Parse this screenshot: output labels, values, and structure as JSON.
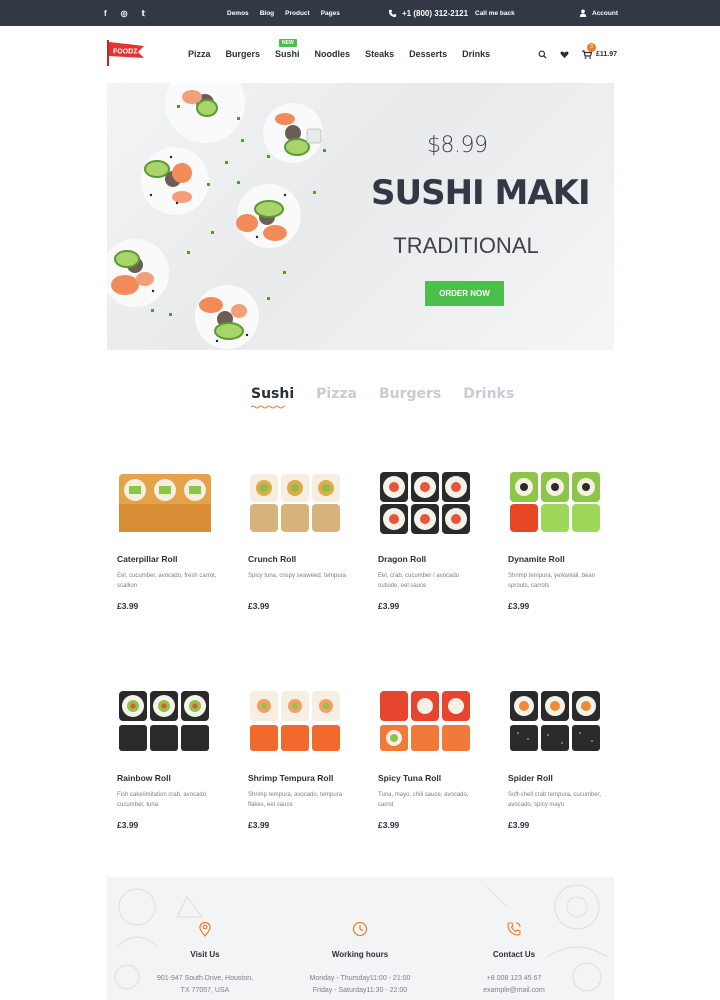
{
  "topbar": {
    "social": [
      "f",
      "◎",
      "𝕥"
    ],
    "links": [
      "Demos",
      "Blog",
      "Product",
      "Pages"
    ],
    "phone": "+1 (800) 312-2121",
    "callme": "Call me back",
    "account": "Account"
  },
  "header": {
    "logo_text": "FOODZ",
    "nav": [
      "Pizza",
      "Burgers",
      "Sushi",
      "Noodles",
      "Steaks",
      "Desserts",
      "Drinks"
    ],
    "new_badge": "NEW",
    "cart_count": "3",
    "cart_total": "£11.97"
  },
  "hero": {
    "price": "$8.99",
    "title": "SUSHI MAKI",
    "subtitle": "TRADITIONAL",
    "cta": "ORDER NOW"
  },
  "tabs": [
    "Sushi",
    "Pizza",
    "Burgers",
    "Drinks"
  ],
  "products": [
    {
      "name": "Caterpillar Roll",
      "desc": "Eel, cucumber, avocado, fresh carrot, scallion",
      "price": "£3.99"
    },
    {
      "name": "Crunch Roll",
      "desc": "Spicy tuna, crispy seaweed, tempura",
      "price": "£3.99"
    },
    {
      "name": "Dragon Roll",
      "desc": "Eel, crab, cucumber / avocado outside, eel sauce",
      "price": "£3.99"
    },
    {
      "name": "Dynamite Roll",
      "desc": "Shrimp tempura, yellowtail, bean sprouts, carrots",
      "price": "£3.99"
    },
    {
      "name": "Rainbow Roll",
      "desc": "Fish cake/imitation crab, avocado, cucumber, tuna",
      "price": "£3.99"
    },
    {
      "name": "Shrimp Tempura Roll",
      "desc": "Shrimp tempura, avocado, tempura flakes, eel sauce",
      "price": "£3.99"
    },
    {
      "name": "Spicy Tuna Roll",
      "desc": "Tuna, mayo, chili sauce, avocado, carrot",
      "price": "£3.99"
    },
    {
      "name": "Spider Roll",
      "desc": "Soft-shell crab tempura, cucumber, avocado, spicy mayo",
      "price": "£3.99"
    }
  ],
  "footer": {
    "visit": {
      "title": "Visit Us",
      "line1": "901-947 South Drive, Houston,",
      "line2": "TX 77057, USA"
    },
    "hours": {
      "title": "Working hours",
      "line1": "Monday - Thursday11:00 - 21:00",
      "line2": "Friday - Saturday11:30 - 22:00"
    },
    "contact": {
      "title": "Contact Us",
      "line1": "+8 008 123 45 67",
      "line2": "example@mail.com"
    }
  },
  "colors": {
    "topbar": "#323844",
    "accent_green": "#4bbf4b",
    "accent_orange": "#f07a23",
    "logo_red": "#e3342f"
  }
}
